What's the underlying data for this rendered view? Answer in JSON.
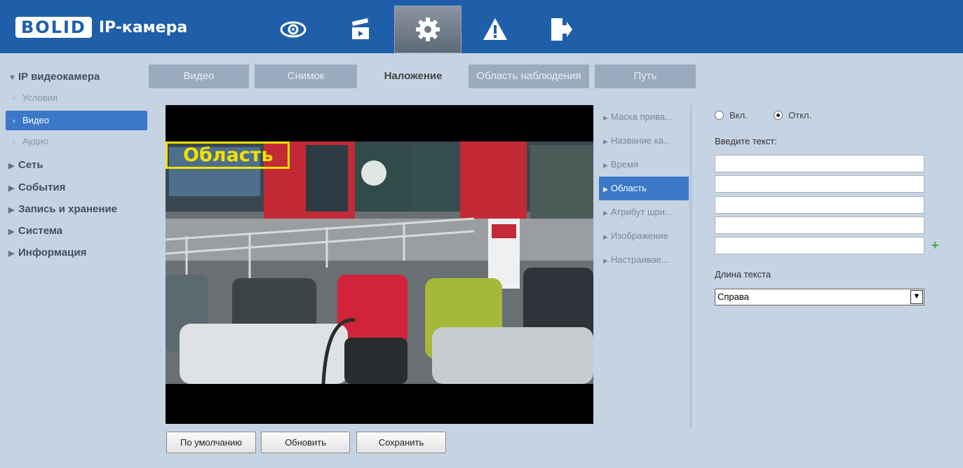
{
  "header": {
    "logo": "BOLID",
    "app_title": "IP-камера",
    "nav": [
      {
        "icon": "eye-icon",
        "active": false
      },
      {
        "icon": "clapperboard-icon",
        "active": false
      },
      {
        "icon": "gear-icon",
        "active": true
      },
      {
        "icon": "warning-icon",
        "active": false
      },
      {
        "icon": "logout-icon",
        "active": false
      }
    ]
  },
  "sidebar": {
    "items": [
      {
        "label": "IP видеокамера",
        "expanded": true
      },
      {
        "label": "Условия"
      },
      {
        "label": "Видео",
        "active": true
      },
      {
        "label": "Аудио"
      },
      {
        "label": "Сеть"
      },
      {
        "label": "События"
      },
      {
        "label": "Запись и хранение"
      },
      {
        "label": "Система"
      },
      {
        "label": "Информация"
      }
    ]
  },
  "tabs": [
    "Видео",
    "Снимок",
    "Наложение",
    "Область наблюдения",
    "Путь"
  ],
  "active_tab": "Наложение",
  "video": {
    "overlay_text": "Область"
  },
  "submenu": {
    "items": [
      "Маска прива...",
      "Название ка...",
      "Время",
      "Область",
      "Атрибут шри...",
      "Изображение",
      "Настраивае..."
    ],
    "active": "Область"
  },
  "form": {
    "radio_on": "Вкл.",
    "radio_off": "Откл.",
    "selected": "Откл.",
    "text_label": "Введите текст:",
    "text_values": [
      "",
      "",
      "",
      "",
      ""
    ],
    "length_label": "Длина текста",
    "length_value": "Справа"
  },
  "buttons": {
    "default": "По умолчанию",
    "refresh": "Обновить",
    "save": "Сохранить"
  },
  "colors": {
    "header": "#1f5faa",
    "accent": "#3d78c8",
    "background": "#c6d3e3",
    "overlay": "#f0e100"
  }
}
